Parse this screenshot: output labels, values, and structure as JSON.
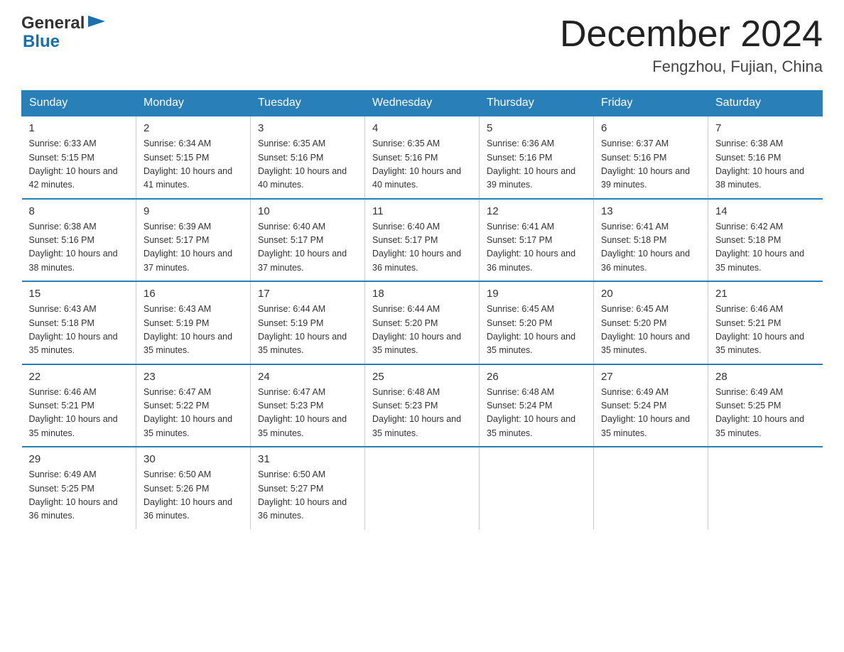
{
  "header": {
    "logo": {
      "text_general": "General",
      "text_blue": "Blue"
    },
    "title": "December 2024",
    "location": "Fengzhou, Fujian, China"
  },
  "days_of_week": [
    "Sunday",
    "Monday",
    "Tuesday",
    "Wednesday",
    "Thursday",
    "Friday",
    "Saturday"
  ],
  "weeks": [
    [
      {
        "day": "1",
        "sunrise": "6:33 AM",
        "sunset": "5:15 PM",
        "daylight": "10 hours and 42 minutes."
      },
      {
        "day": "2",
        "sunrise": "6:34 AM",
        "sunset": "5:15 PM",
        "daylight": "10 hours and 41 minutes."
      },
      {
        "day": "3",
        "sunrise": "6:35 AM",
        "sunset": "5:16 PM",
        "daylight": "10 hours and 40 minutes."
      },
      {
        "day": "4",
        "sunrise": "6:35 AM",
        "sunset": "5:16 PM",
        "daylight": "10 hours and 40 minutes."
      },
      {
        "day": "5",
        "sunrise": "6:36 AM",
        "sunset": "5:16 PM",
        "daylight": "10 hours and 39 minutes."
      },
      {
        "day": "6",
        "sunrise": "6:37 AM",
        "sunset": "5:16 PM",
        "daylight": "10 hours and 39 minutes."
      },
      {
        "day": "7",
        "sunrise": "6:38 AM",
        "sunset": "5:16 PM",
        "daylight": "10 hours and 38 minutes."
      }
    ],
    [
      {
        "day": "8",
        "sunrise": "6:38 AM",
        "sunset": "5:16 PM",
        "daylight": "10 hours and 38 minutes."
      },
      {
        "day": "9",
        "sunrise": "6:39 AM",
        "sunset": "5:17 PM",
        "daylight": "10 hours and 37 minutes."
      },
      {
        "day": "10",
        "sunrise": "6:40 AM",
        "sunset": "5:17 PM",
        "daylight": "10 hours and 37 minutes."
      },
      {
        "day": "11",
        "sunrise": "6:40 AM",
        "sunset": "5:17 PM",
        "daylight": "10 hours and 36 minutes."
      },
      {
        "day": "12",
        "sunrise": "6:41 AM",
        "sunset": "5:17 PM",
        "daylight": "10 hours and 36 minutes."
      },
      {
        "day": "13",
        "sunrise": "6:41 AM",
        "sunset": "5:18 PM",
        "daylight": "10 hours and 36 minutes."
      },
      {
        "day": "14",
        "sunrise": "6:42 AM",
        "sunset": "5:18 PM",
        "daylight": "10 hours and 35 minutes."
      }
    ],
    [
      {
        "day": "15",
        "sunrise": "6:43 AM",
        "sunset": "5:18 PM",
        "daylight": "10 hours and 35 minutes."
      },
      {
        "day": "16",
        "sunrise": "6:43 AM",
        "sunset": "5:19 PM",
        "daylight": "10 hours and 35 minutes."
      },
      {
        "day": "17",
        "sunrise": "6:44 AM",
        "sunset": "5:19 PM",
        "daylight": "10 hours and 35 minutes."
      },
      {
        "day": "18",
        "sunrise": "6:44 AM",
        "sunset": "5:20 PM",
        "daylight": "10 hours and 35 minutes."
      },
      {
        "day": "19",
        "sunrise": "6:45 AM",
        "sunset": "5:20 PM",
        "daylight": "10 hours and 35 minutes."
      },
      {
        "day": "20",
        "sunrise": "6:45 AM",
        "sunset": "5:20 PM",
        "daylight": "10 hours and 35 minutes."
      },
      {
        "day": "21",
        "sunrise": "6:46 AM",
        "sunset": "5:21 PM",
        "daylight": "10 hours and 35 minutes."
      }
    ],
    [
      {
        "day": "22",
        "sunrise": "6:46 AM",
        "sunset": "5:21 PM",
        "daylight": "10 hours and 35 minutes."
      },
      {
        "day": "23",
        "sunrise": "6:47 AM",
        "sunset": "5:22 PM",
        "daylight": "10 hours and 35 minutes."
      },
      {
        "day": "24",
        "sunrise": "6:47 AM",
        "sunset": "5:23 PM",
        "daylight": "10 hours and 35 minutes."
      },
      {
        "day": "25",
        "sunrise": "6:48 AM",
        "sunset": "5:23 PM",
        "daylight": "10 hours and 35 minutes."
      },
      {
        "day": "26",
        "sunrise": "6:48 AM",
        "sunset": "5:24 PM",
        "daylight": "10 hours and 35 minutes."
      },
      {
        "day": "27",
        "sunrise": "6:49 AM",
        "sunset": "5:24 PM",
        "daylight": "10 hours and 35 minutes."
      },
      {
        "day": "28",
        "sunrise": "6:49 AM",
        "sunset": "5:25 PM",
        "daylight": "10 hours and 35 minutes."
      }
    ],
    [
      {
        "day": "29",
        "sunrise": "6:49 AM",
        "sunset": "5:25 PM",
        "daylight": "10 hours and 36 minutes."
      },
      {
        "day": "30",
        "sunrise": "6:50 AM",
        "sunset": "5:26 PM",
        "daylight": "10 hours and 36 minutes."
      },
      {
        "day": "31",
        "sunrise": "6:50 AM",
        "sunset": "5:27 PM",
        "daylight": "10 hours and 36 minutes."
      },
      null,
      null,
      null,
      null
    ]
  ]
}
